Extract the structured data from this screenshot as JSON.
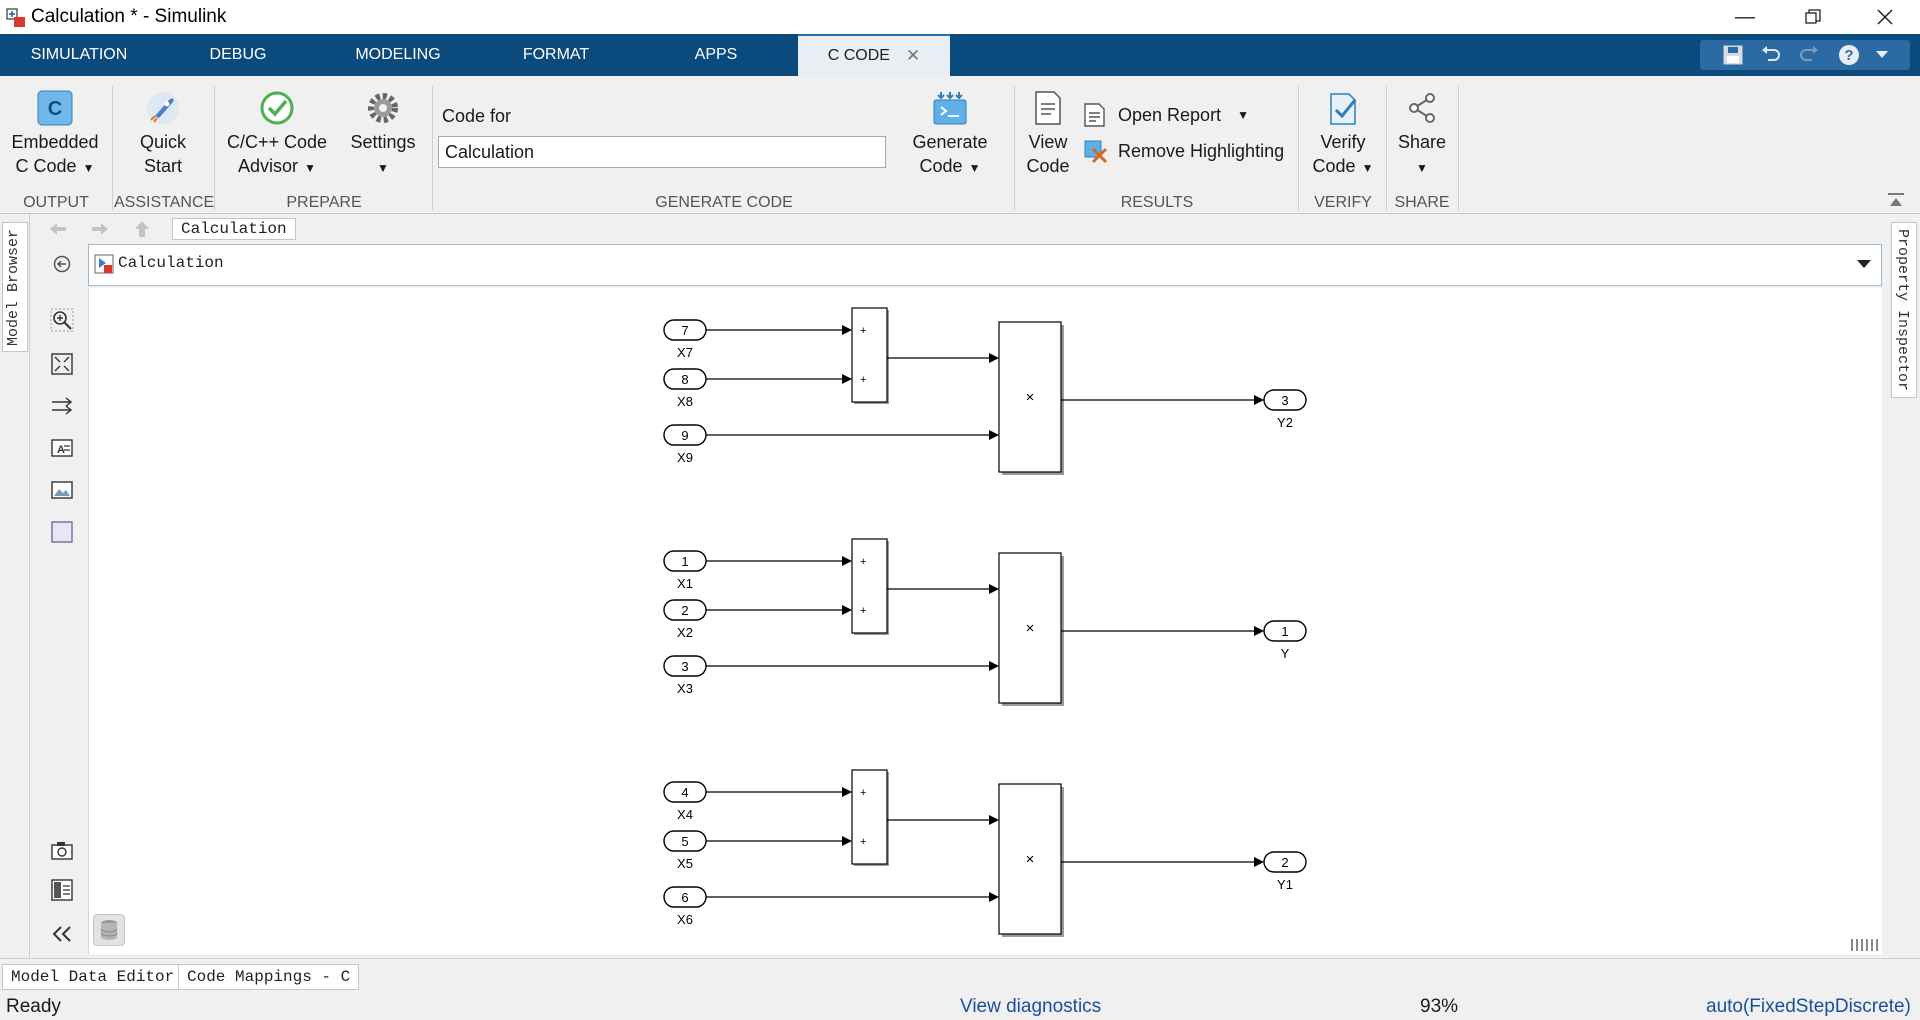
{
  "window": {
    "title": "Calculation * - Simulink"
  },
  "tabs": [
    {
      "label": "SIMULATION"
    },
    {
      "label": "DEBUG"
    },
    {
      "label": "MODELING"
    },
    {
      "label": "FORMAT"
    },
    {
      "label": "APPS"
    },
    {
      "label": "C CODE",
      "active": true
    }
  ],
  "toolstrip": {
    "output": {
      "label": "OUTPUT",
      "embedded_line1": "Embedded",
      "embedded_line2": "C Code",
      "icon_letter": "C"
    },
    "assistance": {
      "label": "ASSISTANCE",
      "quick_line1": "Quick",
      "quick_line2": "Start"
    },
    "prepare": {
      "label": "PREPARE",
      "advisor_line1": "C/C++ Code",
      "advisor_line2": "Advisor",
      "settings": "Settings"
    },
    "generate_code": {
      "label": "GENERATE CODE",
      "code_for_label": "Code for",
      "code_for_value": "Calculation",
      "generate_line1": "Generate",
      "generate_line2": "Code"
    },
    "results": {
      "label": "RESULTS",
      "view_line1": "View",
      "view_line2": "Code",
      "open_report": "Open Report",
      "remove_highlighting": "Remove Highlighting"
    },
    "verify": {
      "label": "VERIFY",
      "verify_line1": "Verify",
      "verify_line2": "Code"
    },
    "share": {
      "label": "SHARE",
      "share": "Share"
    }
  },
  "side_tabs": {
    "model_browser": "Model Browser",
    "property_inspector": "Property Inspector"
  },
  "breadcrumb": {
    "nav_item": "Calculation",
    "address": "Calculation"
  },
  "palette_icons": [
    "back-icon",
    "zoom-icon",
    "fit-view-icon",
    "route-lines-icon",
    "annotation-icon",
    "image-icon",
    "area-icon",
    "camera-icon",
    "model-explorer-icon",
    "collapse-icon"
  ],
  "diagram": {
    "groups": [
      {
        "inports": [
          {
            "num": "7",
            "name": "X7"
          },
          {
            "num": "8",
            "name": "X8"
          },
          {
            "num": "9",
            "name": "X9"
          }
        ],
        "sum_signs": [
          "+",
          "+"
        ],
        "product_symbol": "×",
        "outport": {
          "num": "3",
          "name": "Y2"
        }
      },
      {
        "inports": [
          {
            "num": "1",
            "name": "X1"
          },
          {
            "num": "2",
            "name": "X2"
          },
          {
            "num": "3",
            "name": "X3"
          }
        ],
        "sum_signs": [
          "+",
          "+"
        ],
        "product_symbol": "×",
        "outport": {
          "num": "1",
          "name": "Y"
        }
      },
      {
        "inports": [
          {
            "num": "4",
            "name": "X4"
          },
          {
            "num": "5",
            "name": "X5"
          },
          {
            "num": "6",
            "name": "X6"
          }
        ],
        "sum_signs": [
          "+",
          "+"
        ],
        "product_symbol": "×",
        "outport": {
          "num": "2",
          "name": "Y1"
        }
      }
    ]
  },
  "bottom_tabs": [
    "Model Data Editor",
    "Code Mappings - C"
  ],
  "status": {
    "ready": "Ready",
    "diagnostics": "View diagnostics",
    "zoom": "93%",
    "solver": "auto(FixedStepDiscrete)"
  },
  "colors": {
    "tab_bar": "#0b4a7d",
    "link": "#1a4fa0",
    "toolstrip_bg": "#f0f0f0"
  }
}
